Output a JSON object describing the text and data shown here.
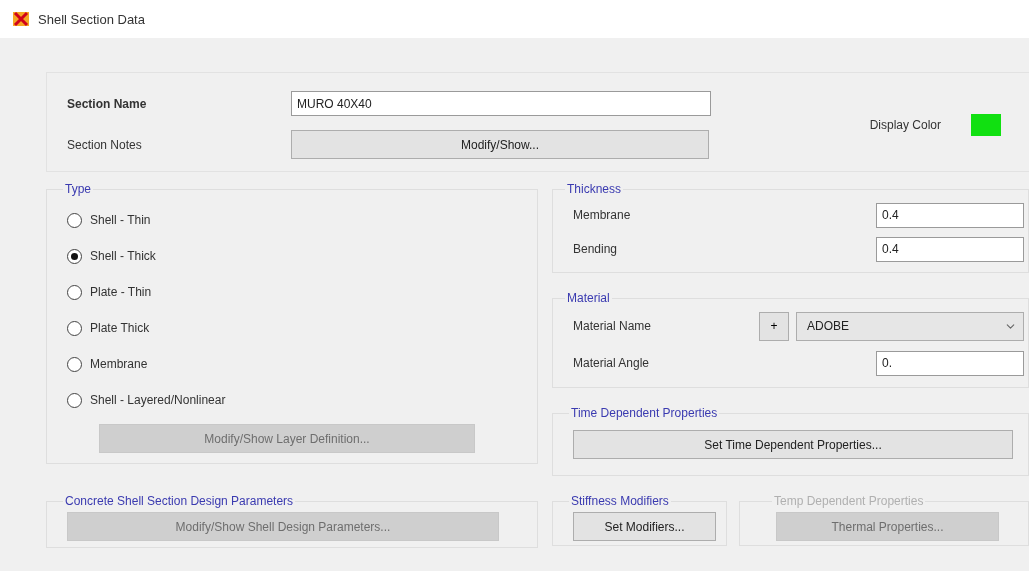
{
  "window": {
    "title": "Shell Section Data"
  },
  "section": {
    "name_label": "Section Name",
    "name_value": "MURO 40X40",
    "notes_label": "Section Notes",
    "notes_button": "Modify/Show...",
    "display_color_label": "Display Color",
    "color": "#11e011"
  },
  "type": {
    "title": "Type",
    "options": [
      {
        "label": "Shell - Thin",
        "selected": false
      },
      {
        "label": "Shell - Thick",
        "selected": true
      },
      {
        "label": "Plate - Thin",
        "selected": false
      },
      {
        "label": "Plate Thick",
        "selected": false
      },
      {
        "label": "Membrane",
        "selected": false
      },
      {
        "label": "Shell - Layered/Nonlinear",
        "selected": false
      }
    ],
    "button": {
      "label": "Modify/Show Layer Definition...",
      "disabled": true
    }
  },
  "concrete": {
    "title": "Concrete Shell Section Design Parameters",
    "button": {
      "label": "Modify/Show Shell Design Parameters...",
      "disabled": true
    }
  },
  "thickness": {
    "title": "Thickness",
    "fields": [
      {
        "label": "Membrane",
        "value": "0.4"
      },
      {
        "label": "Bending",
        "value": "0.4"
      }
    ]
  },
  "material": {
    "title": "Material",
    "name_label": "Material Name",
    "add_button": "+",
    "name_value": "ADOBE",
    "angle_label": "Material Angle",
    "angle_value": "0."
  },
  "time_dependent": {
    "title": "Time Dependent Properties",
    "button": {
      "label": "Set Time Dependent Properties...",
      "disabled": false
    }
  },
  "stiffness": {
    "title": "Stiffness Modifiers",
    "button": {
      "label": "Set Modifiers...",
      "disabled": false
    }
  },
  "temp": {
    "title": "Temp Dependent Properties",
    "disabled": true,
    "button": {
      "label": "Thermal Properties...",
      "disabled": true
    }
  }
}
